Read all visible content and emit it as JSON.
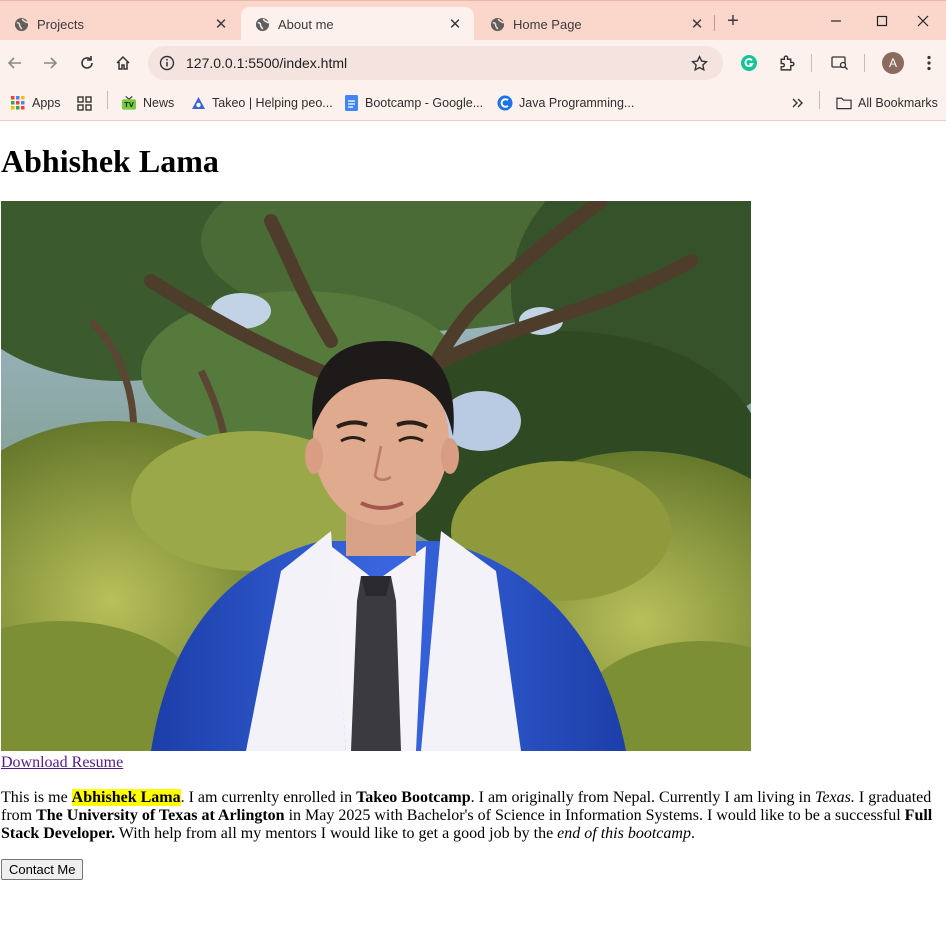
{
  "browser": {
    "tabs": [
      {
        "label": "Projects",
        "active": false
      },
      {
        "label": "About me",
        "active": true
      },
      {
        "label": "Home Page",
        "active": false
      }
    ],
    "url": "127.0.0.1:5500/index.html",
    "profile_initial": "A",
    "bookmarks": [
      {
        "label": "Apps",
        "icon": "apps-grid-icon"
      },
      {
        "label": "News",
        "icon": "tv-icon"
      },
      {
        "label": "Takeo | Helping peo...",
        "icon": "takeo-icon"
      },
      {
        "label": "Bootcamp - Google...",
        "icon": "google-docs-icon"
      },
      {
        "label": "Java Programming...",
        "icon": "c-logo-icon"
      }
    ],
    "all_bookmarks_label": "All Bookmarks",
    "colors": {
      "tabstrip": "#fbd6cb",
      "toolbar": "#fdf1ed",
      "accent_grammarly": "#15c39a"
    }
  },
  "page": {
    "heading": "Abhishek Lama",
    "photo_alt": "Graduation photo",
    "resume_link": "Download Resume",
    "bio": {
      "p1": "This is me ",
      "name": "Abhishek Lama",
      "p2": ". I am currenlty enrolled in ",
      "bootcamp": "Takeo Bootcamp",
      "p3": ". I am originally from Nepal. Currently I am living in ",
      "state": "Texas.",
      "p4": " I graduated from ",
      "university": "The University of Texas at Arlington",
      "p5": " in May 2025 with Bachelor's of Science in Information Systems. I would like to be a successful ",
      "role": "Full Stack Developer.",
      "p6": " With help from all my mentors I would like to get a good job by the ",
      "ending": "end of this bootcamp",
      "p7": "."
    },
    "contact_button": "Contact Me"
  }
}
